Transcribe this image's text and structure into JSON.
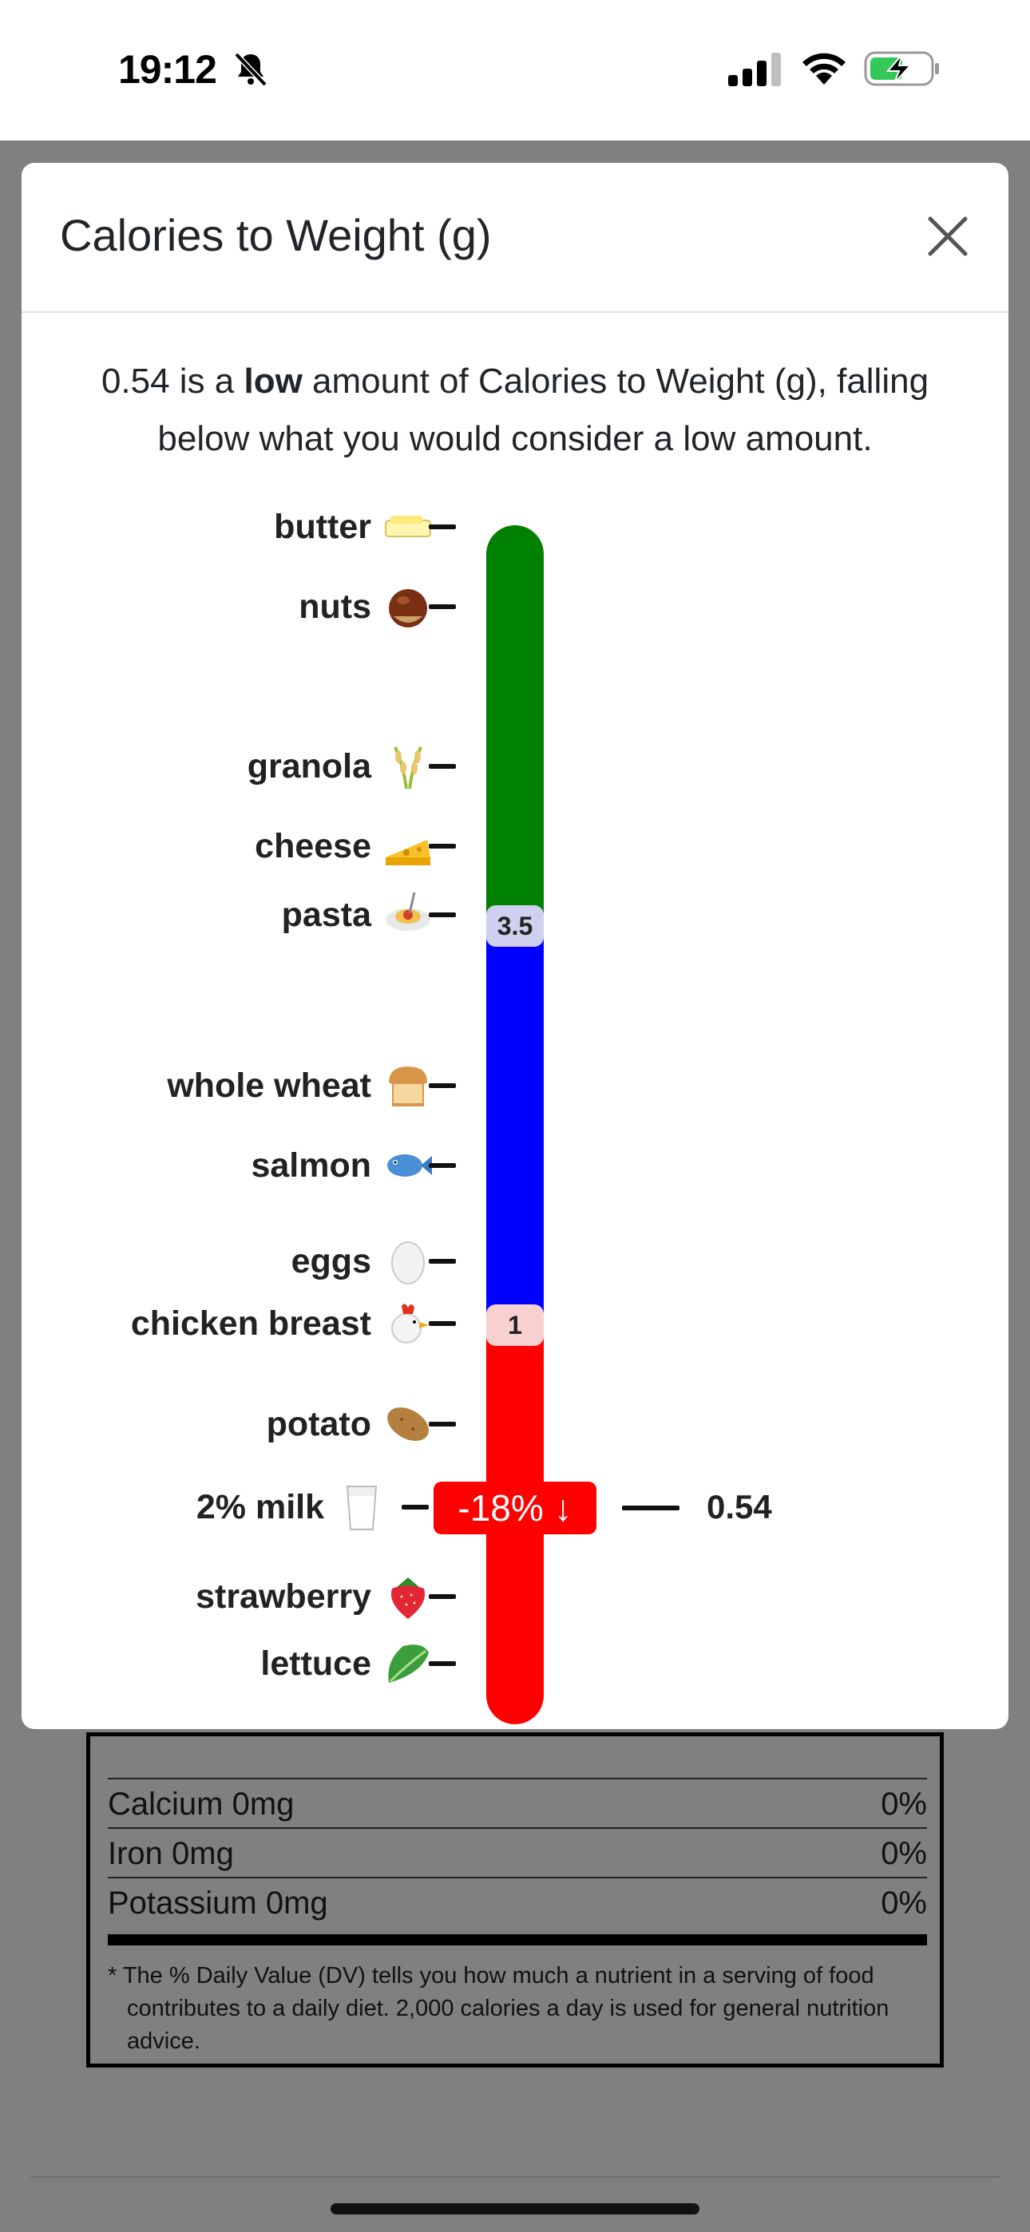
{
  "status_bar": {
    "time": "19:12"
  },
  "modal": {
    "title": "Calories to Weight (g)",
    "description": {
      "value": "0.54",
      "pre": " is a ",
      "level": "low",
      "post": " amount of Calories to Weight (g), falling below what you would consider a low amount."
    },
    "thresholds": [
      "3.5",
      "1"
    ],
    "current": {
      "badge": "-18% ↓",
      "value": "0.54"
    },
    "colors": {
      "high": "#008000",
      "medium": "#0000ff",
      "low": "#ff0000"
    },
    "foods": [
      {
        "label": "butter",
        "icon": "butter-icon"
      },
      {
        "label": "nuts",
        "icon": "chestnut-icon"
      },
      {
        "label": "granola",
        "icon": "rice-stalk-icon"
      },
      {
        "label": "cheese",
        "icon": "cheese-icon"
      },
      {
        "label": "pasta",
        "icon": "spaghetti-icon"
      },
      {
        "label": "whole wheat",
        "icon": "bread-icon"
      },
      {
        "label": "salmon",
        "icon": "fish-icon"
      },
      {
        "label": "eggs",
        "icon": "egg-icon"
      },
      {
        "label": "chicken breast",
        "icon": "chicken-icon"
      },
      {
        "label": "potato",
        "icon": "potato-icon"
      },
      {
        "label": "2% milk",
        "icon": "milk-glass-icon"
      },
      {
        "label": "strawberry",
        "icon": "strawberry-icon"
      },
      {
        "label": "lettuce",
        "icon": "lettuce-icon"
      }
    ]
  },
  "nutrition": {
    "rows": [
      {
        "name": "Calcium 0mg",
        "dv": "0%"
      },
      {
        "name": "Iron 0mg",
        "dv": "0%"
      },
      {
        "name": "Potassium 0mg",
        "dv": "0%"
      }
    ],
    "footnote": "* The % Daily Value (DV) tells you how much a nutrient in a serving of food contributes to a daily diet. 2,000 calories a day is used for general nutrition advice."
  }
}
